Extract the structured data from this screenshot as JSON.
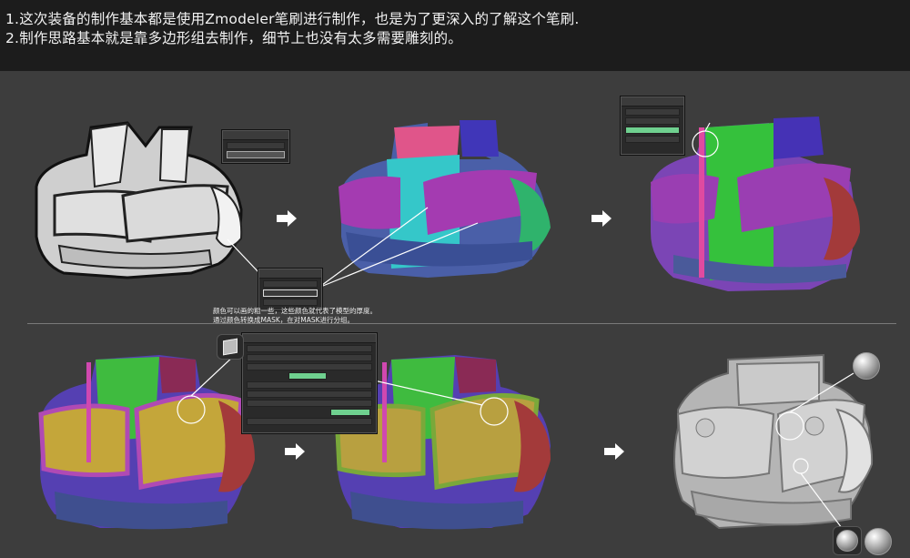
{
  "header": {
    "line1": "1.这次装备的制作基本都是使用Zmodeler笔刷进行制作，也是为了更深入的了解这个笔刷.",
    "line2": "2.制作思路基本就是靠多边形组去制作，细节上也没有太多需要雕刻的。"
  },
  "caption": {
    "line1": "颜色可以画的粗一些，这些颜色就代表了模型的厚度。",
    "line2": "通过颜色转换成MASK，在对MASK进行分组。"
  },
  "colors": {
    "background": "#3a3a3a",
    "header_bg": "#1c1c1c",
    "menu_highlight": "#6fd08f",
    "annotation": "#ffffff"
  },
  "icons": [
    "arrow-right-icon",
    "matcap-sphere-icon",
    "brush-icon",
    "zmodeler-icon",
    "cube-icon"
  ]
}
